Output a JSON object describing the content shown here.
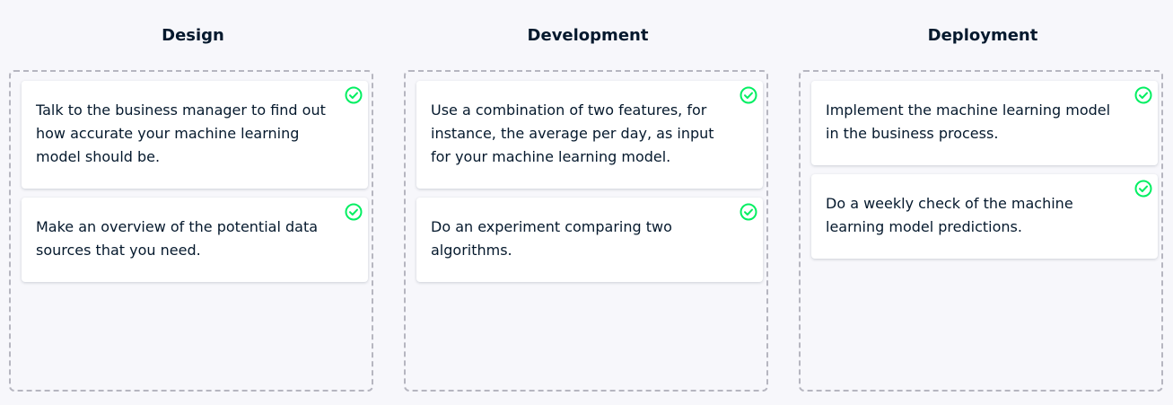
{
  "columns": [
    {
      "title": "Design",
      "cards": [
        {
          "text": "Talk to the business manager to find out how accurate your machine learning model should be.",
          "status_icon": "check-circle-icon"
        },
        {
          "text": "Make an overview of the potential data sources that you need.",
          "status_icon": "check-circle-icon"
        }
      ]
    },
    {
      "title": "Development",
      "cards": [
        {
          "text": "Use a combination of two features, for instance, the average per day, as input for your machine learning model.",
          "status_icon": "check-circle-icon"
        },
        {
          "text": "Do an experiment comparing two algorithms.",
          "status_icon": "check-circle-icon"
        }
      ]
    },
    {
      "title": "Deployment",
      "cards": [
        {
          "text": "Implement the machine learning model in the business process.",
          "status_icon": "check-circle-icon"
        },
        {
          "text": "Do a weekly check of the machine learning model predictions.",
          "status_icon": "check-circle-icon"
        }
      ]
    }
  ],
  "colors": {
    "correct": "#03ef62",
    "text": "#05192d",
    "background": "#f7f7fb",
    "dropzone_border": "#b6b6c0"
  }
}
